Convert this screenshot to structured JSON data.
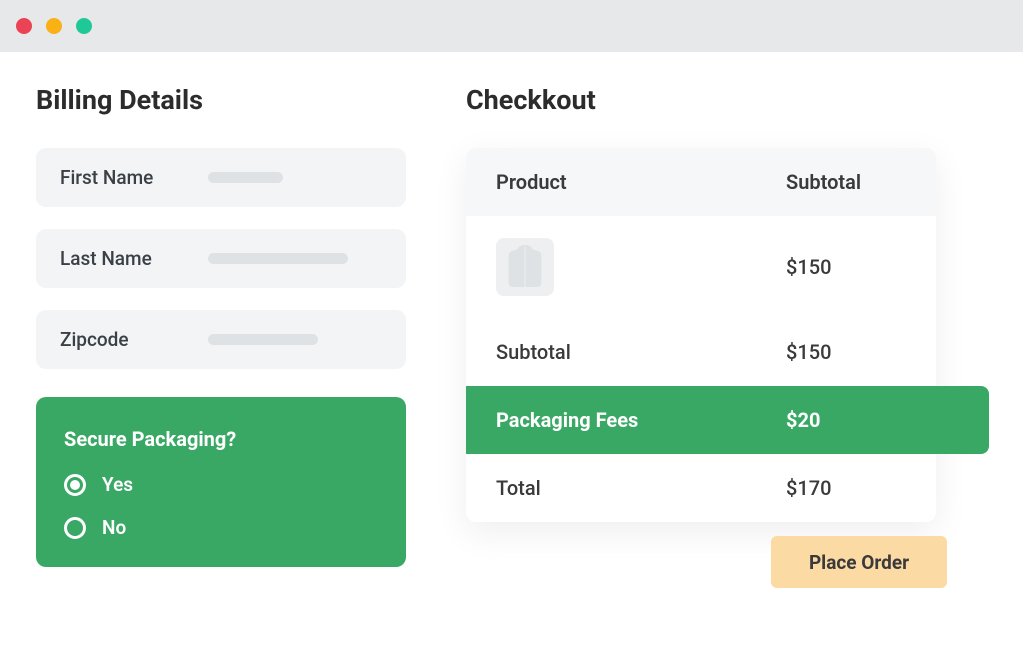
{
  "billing": {
    "heading": "Billing Details",
    "fields": {
      "first_name": "First Name",
      "last_name": "Last Name",
      "zipcode": "Zipcode"
    },
    "secure_packaging": {
      "title": "Secure Packaging?",
      "yes": "Yes",
      "no": "No",
      "selected": "yes"
    }
  },
  "checkout": {
    "heading": "Checkkout",
    "header_left": "Product",
    "header_right": "Subtotal",
    "items": [
      {
        "price": "$150"
      }
    ],
    "subtotal_label": "Subtotal",
    "subtotal_value": "$150",
    "packaging_label": "Packaging Fees",
    "packaging_value": "$20",
    "total_label": "Total",
    "total_value": "$170",
    "place_order": "Place Order"
  }
}
